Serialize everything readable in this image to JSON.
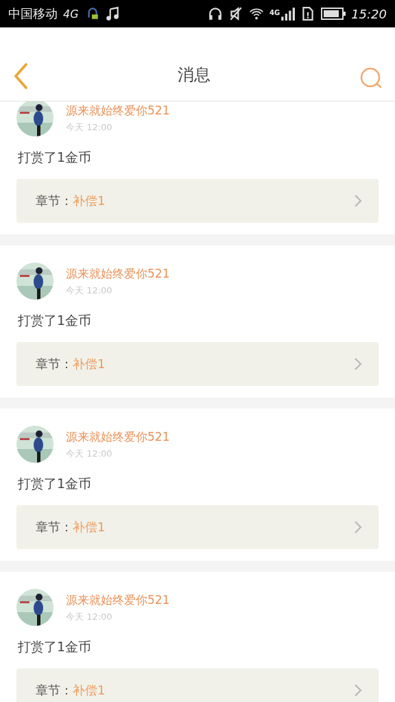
{
  "status_bar": {
    "carrier": "中国移动",
    "network": "4G",
    "signal_label": "4G",
    "time": "15:20"
  },
  "header": {
    "title": "消息"
  },
  "messages": [
    {
      "name": "源来就始终爱你521",
      "time": "今天 12:00",
      "text": "打赏了1金币",
      "chapter_label": "章节：",
      "chapter": "补偿1"
    },
    {
      "name": "源来就始终爱你521",
      "time": "今天 12:00",
      "text": "打赏了1金币",
      "chapter_label": "章节：",
      "chapter": "补偿1"
    },
    {
      "name": "源来就始终爱你521",
      "time": "今天 12:00",
      "text": "打赏了1金币",
      "chapter_label": "章节：",
      "chapter": "补偿1"
    },
    {
      "name": "源来就始终爱你521",
      "time": "今天 12:00",
      "text": "打赏了1金币",
      "chapter_label": "章节：",
      "chapter": "补偿1"
    }
  ]
}
